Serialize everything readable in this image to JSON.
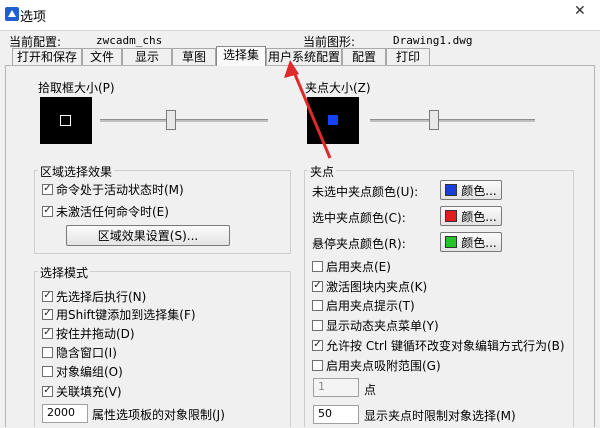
{
  "window": {
    "title": "选项",
    "close_glyph": "✕"
  },
  "header": {
    "profile_label": "当前配置:",
    "profile_value": "zwcadm_chs",
    "drawing_label": "当前图形:",
    "drawing_value": "Drawing1.dwg"
  },
  "tabs": [
    "打开和保存",
    "文件",
    "显示",
    "草图",
    "选择集",
    "用户系统配置",
    "配置",
    "打印"
  ],
  "active_tab": "选择集",
  "pickbox": {
    "label": "拾取框大小(P)",
    "level": 0.42
  },
  "grip_size": {
    "label": "夹点大小(Z)",
    "level": 0.38
  },
  "area_selection": {
    "title": "区域选择效果",
    "items": [
      {
        "label": "命令处于活动状态时(M)",
        "checked": "✓"
      },
      {
        "label": "未激活任何命令时(E)",
        "checked": "✓"
      }
    ],
    "settings_button": "区域效果设置(S)..."
  },
  "selection_modes": {
    "title": "选择模式",
    "items": [
      {
        "label": "先选择后执行(N)",
        "checked": "✓"
      },
      {
        "label": "用Shift键添加到选择集(F)",
        "checked": "✓"
      },
      {
        "label": "按住并拖动(D)",
        "checked": "✓"
      },
      {
        "label": "隐含窗口(I)",
        "checked": ""
      },
      {
        "label": "对象编组(O)",
        "checked": ""
      },
      {
        "label": "关联填充(V)",
        "checked": "✓"
      }
    ],
    "limit_value": "2000",
    "limit_label": "属性选项板的对象限制(J)"
  },
  "grips": {
    "title": "夹点",
    "unselected_label": "未选中夹点颜色(U):",
    "selected_label": "选中夹点颜色(C):",
    "hover_label": "悬停夹点颜色(R):",
    "color_button": "颜色...",
    "colors": {
      "unselected": "#1a3fd6",
      "selected": "#e01c1c",
      "hover": "#22c42a",
      "grip_preview": "#1440ff"
    },
    "items": [
      {
        "label": "启用夹点(E)",
        "checked": ""
      },
      {
        "label": "激活图块内夹点(K)",
        "checked": "✓"
      },
      {
        "label": "启用夹点提示(T)",
        "checked": ""
      },
      {
        "label": "显示动态夹点菜单(Y)",
        "checked": ""
      },
      {
        "label": "允许按 Ctrl 键循环改变对象编辑方式行为(B)",
        "checked": "✓"
      },
      {
        "label": "启用夹点吸附范围(G)",
        "checked": ""
      }
    ],
    "snap_value": "1",
    "snap_unit": "点",
    "limit_value": "50",
    "limit_label": "显示夹点时限制对象选择(M)"
  },
  "colors": {
    "annotation_arrow": "#e02a2a"
  }
}
